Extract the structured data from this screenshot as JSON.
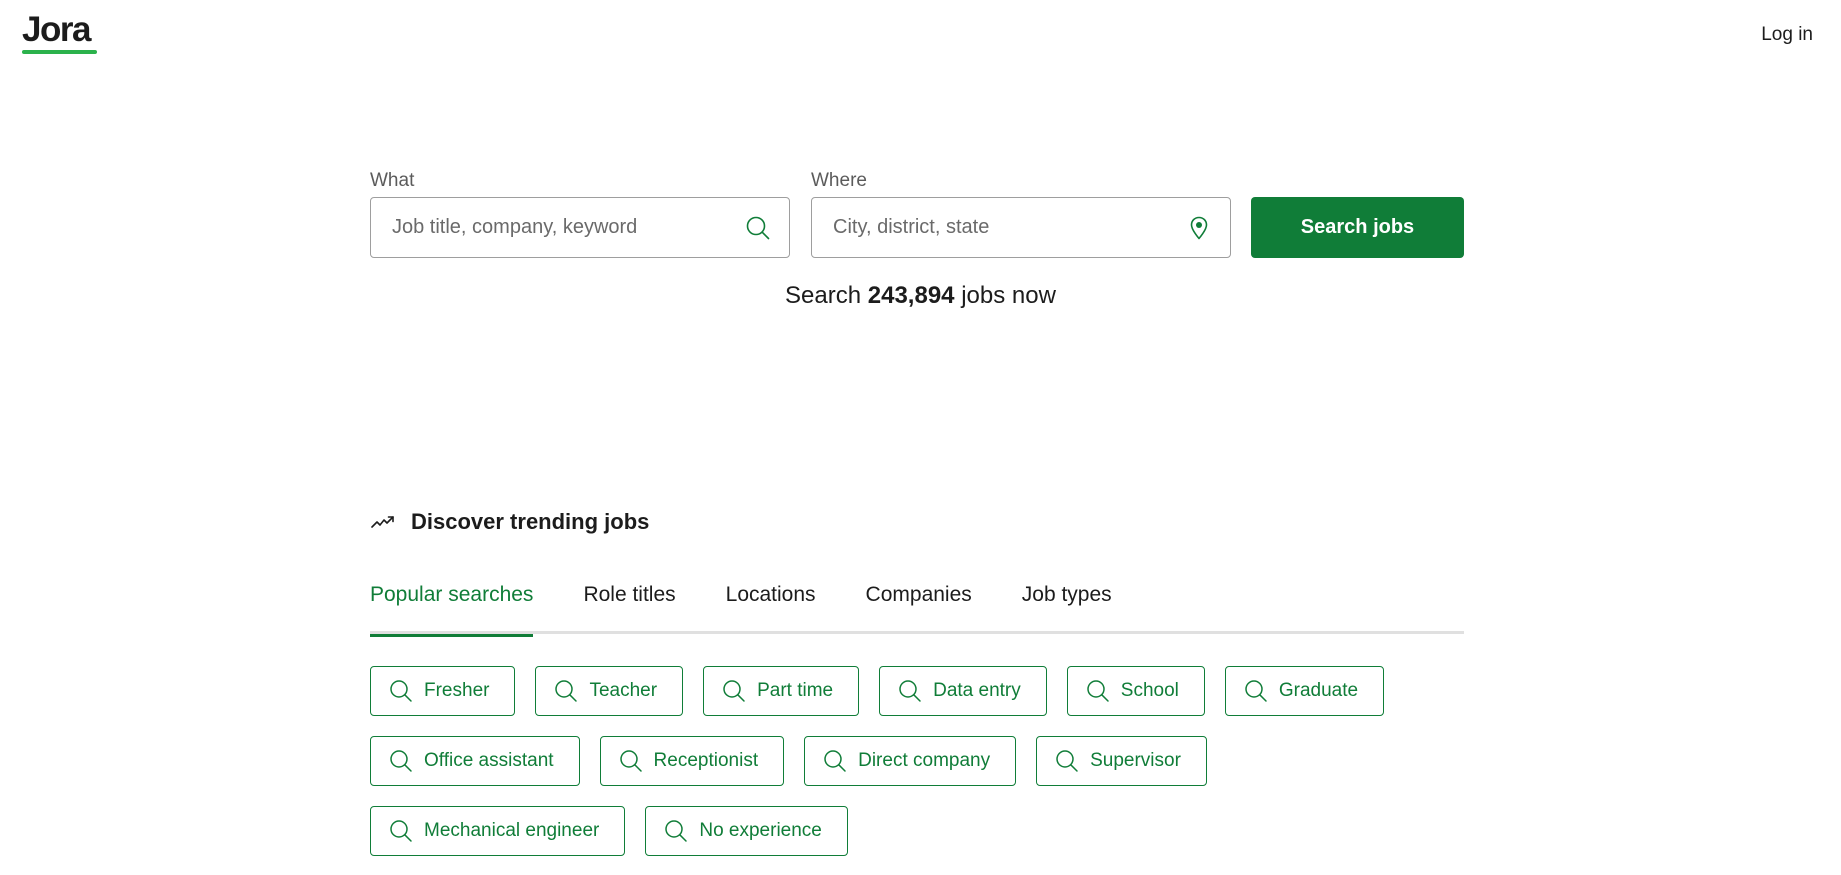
{
  "header": {
    "logo_text": "Jora",
    "login_label": "Log in"
  },
  "search": {
    "what": {
      "label": "What",
      "value": "",
      "placeholder": "Job title, company, keyword",
      "icon": "search-icon"
    },
    "where": {
      "label": "Where",
      "value": "",
      "placeholder": "City, district, state",
      "icon": "location-pin-icon"
    },
    "button_label": "Search jobs",
    "job_count": {
      "prefix": "Search",
      "count": "243,894",
      "suffix": "jobs now"
    }
  },
  "trending": {
    "icon": "trending-up-icon",
    "title": "Discover trending jobs",
    "tabs": [
      {
        "label": "Popular searches",
        "active": true
      },
      {
        "label": "Role titles",
        "active": false
      },
      {
        "label": "Locations",
        "active": false
      },
      {
        "label": "Companies",
        "active": false
      },
      {
        "label": "Job types",
        "active": false
      }
    ],
    "chips": [
      {
        "label": "Fresher"
      },
      {
        "label": "Teacher"
      },
      {
        "label": "Part time"
      },
      {
        "label": "Data entry"
      },
      {
        "label": "School"
      },
      {
        "label": "Graduate"
      },
      {
        "label": "Office assistant"
      },
      {
        "label": "Receptionist"
      },
      {
        "label": "Direct company"
      },
      {
        "label": "Supervisor"
      },
      {
        "label": "Mechanical engineer"
      },
      {
        "label": "No experience"
      }
    ]
  },
  "colors": {
    "brand_green": "#107d38",
    "logo_bar_green": "#2bb24c",
    "text": "#1c1c1c",
    "muted_text": "#5b5b5b",
    "input_border": "#9e9e9e",
    "tab_divider": "#e0e0e0"
  }
}
